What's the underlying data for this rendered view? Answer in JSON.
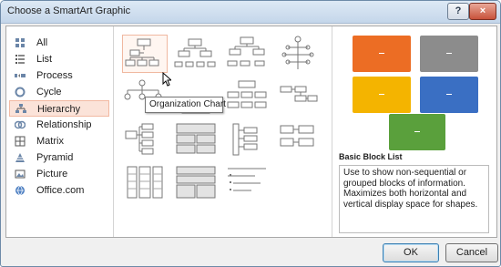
{
  "window": {
    "title": "Choose a SmartArt Graphic",
    "help": "?",
    "close": "×"
  },
  "categories": [
    {
      "label": "All",
      "icon": "all-icon"
    },
    {
      "label": "List",
      "icon": "list-icon"
    },
    {
      "label": "Process",
      "icon": "process-icon"
    },
    {
      "label": "Cycle",
      "icon": "cycle-icon"
    },
    {
      "label": "Hierarchy",
      "icon": "hierarchy-icon",
      "selected": true
    },
    {
      "label": "Relationship",
      "icon": "relationship-icon"
    },
    {
      "label": "Matrix",
      "icon": "matrix-icon"
    },
    {
      "label": "Pyramid",
      "icon": "pyramid-icon"
    },
    {
      "label": "Picture",
      "icon": "picture-icon"
    },
    {
      "label": "Office.com",
      "icon": "office-com-icon"
    }
  ],
  "layouts": {
    "tooltip": "Organization Chart"
  },
  "preview": {
    "blocks": [
      "#ec6d24",
      "#8c8c8c",
      "#f4b400",
      "#3a6fc3",
      "#5aa03c"
    ],
    "title": "Basic Block List",
    "description": "Use to show non-sequential or grouped blocks of information. Maximizes both horizontal and vertical display space for shapes."
  },
  "buttons": {
    "ok": "OK",
    "cancel": "Cancel"
  }
}
